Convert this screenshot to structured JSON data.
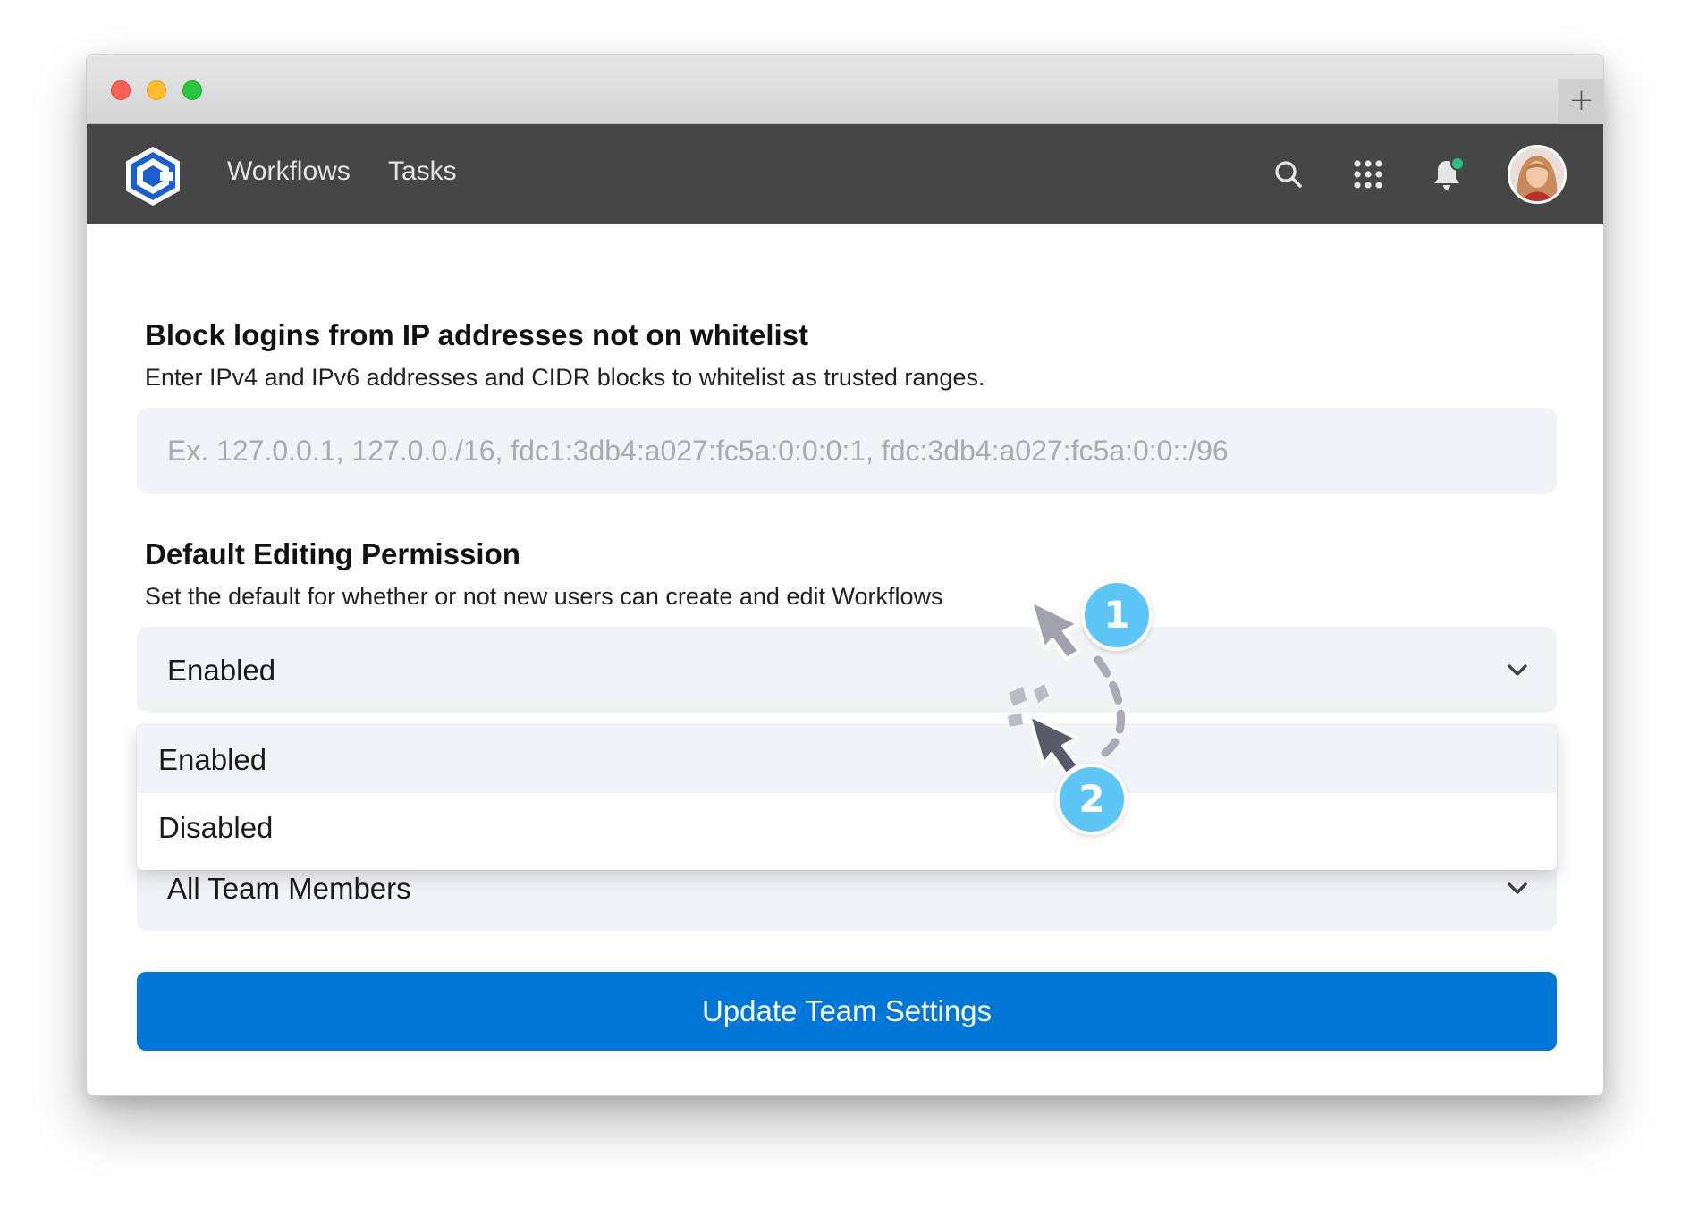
{
  "navbar": {
    "links": [
      {
        "label": "Workflows"
      },
      {
        "label": "Tasks"
      }
    ],
    "icons": [
      "logo-icon",
      "search-icon",
      "apps-grid-icon",
      "bell-icon",
      "avatar"
    ],
    "notification_dot_color": "#26c281"
  },
  "ip_whitelist": {
    "title": "Block logins from IP addresses not on whitelist",
    "description": "Enter IPv4 and IPv6 addresses and CIDR blocks to whitelist as trusted ranges.",
    "placeholder": "Ex. 127.0.0.1, 127.0.0./16, fdc1:3db4:a027:fc5a:0:0:0:1, fdc:3db4:a027:fc5a:0:0::/96",
    "value": ""
  },
  "editing_permission": {
    "title": "Default Editing Permission",
    "description": "Set the default for whether or not new users can create and edit Workflows",
    "selected": "Enabled",
    "options": [
      "Enabled",
      "Disabled"
    ],
    "hovered_option": "Enabled"
  },
  "visibility_select": {
    "selected": "All Team Members"
  },
  "submit": {
    "label": "Update Team Settings"
  },
  "steps": [
    {
      "label": "1"
    },
    {
      "label": "2"
    }
  ],
  "colors": {
    "primary": "#0077d7",
    "navbar": "#464646",
    "step_badge": "#5ec6f6"
  }
}
